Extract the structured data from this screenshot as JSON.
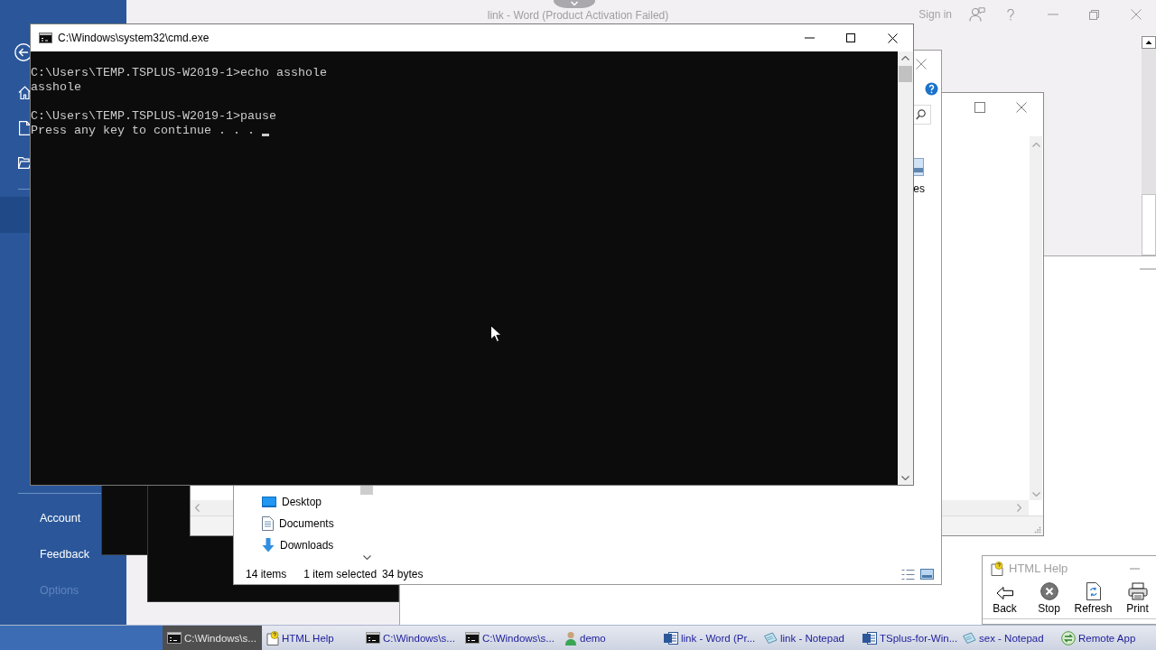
{
  "word_window": {
    "title": "link - Word (Product Activation Failed)",
    "sign_in": "Sign in",
    "sidebar": {
      "items": [
        {
          "label": "Account",
          "disabled": false
        },
        {
          "label": "Feedback",
          "disabled": false
        },
        {
          "label": "Options",
          "disabled": true
        }
      ]
    }
  },
  "console_window": {
    "title": "C:\\Windows\\system32\\cmd.exe",
    "blocks": [
      [
        "C:\\Users\\TEMP.TSPLUS-W2019-1>echo asshole",
        "asshole"
      ],
      [
        "C:\\Users\\TEMP.TSPLUS-W2019-1>pause",
        "Press any key to continue . . ."
      ]
    ],
    "cursor_visible": true
  },
  "explorer_window": {
    "partial_label": "es",
    "nav_items": [
      {
        "kind": "desktop",
        "label": "Desktop"
      },
      {
        "kind": "documents",
        "label": "Documents"
      },
      {
        "kind": "downloads",
        "label": "Downloads"
      }
    ],
    "status": [
      "14 items",
      "1 item selected",
      "34 bytes"
    ]
  },
  "help_window": {
    "title": "HTML Help",
    "buttons": [
      {
        "kind": "back",
        "label": "Back"
      },
      {
        "kind": "stop",
        "label": "Stop"
      },
      {
        "kind": "refresh",
        "label": "Refresh"
      },
      {
        "kind": "print",
        "label": "Print"
      }
    ]
  },
  "taskbar": {
    "items": [
      {
        "kind": "console",
        "label": "C:\\Windows\\s...",
        "selected": true
      },
      {
        "kind": "help",
        "label": "HTML Help",
        "selected": false
      },
      {
        "kind": "console",
        "label": "C:\\Windows\\s...",
        "selected": false
      },
      {
        "kind": "console",
        "label": "C:\\Windows\\s...",
        "selected": false
      },
      {
        "kind": "user",
        "label": "demo",
        "selected": false
      },
      {
        "kind": "word",
        "label": "link - Word (Pr...",
        "selected": false
      },
      {
        "kind": "notepad",
        "label": "link - Notepad",
        "selected": false
      },
      {
        "kind": "word",
        "label": "TSplus-for-Win...",
        "selected": false
      },
      {
        "kind": "notepad",
        "label": "sex - Notepad",
        "selected": false
      },
      {
        "kind": "remote",
        "label": "Remote App",
        "selected": false
      }
    ]
  }
}
